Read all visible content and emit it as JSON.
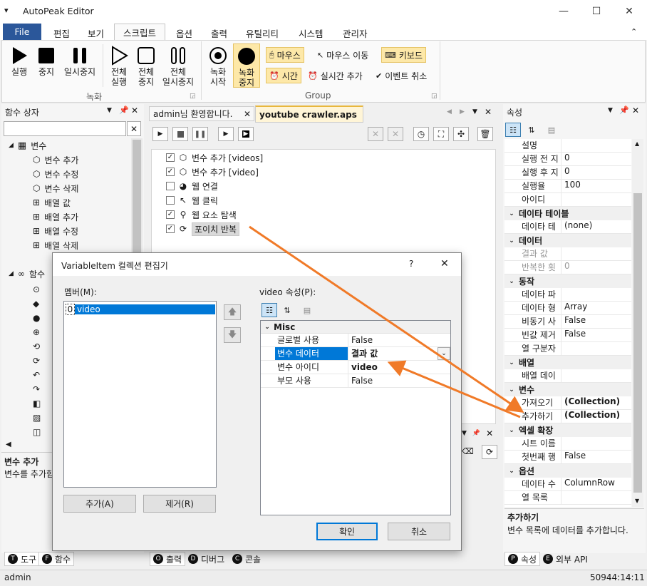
{
  "app": {
    "title": "AutoPeak Editor"
  },
  "menu": {
    "file": "File",
    "items": [
      "편집",
      "보기",
      "스크립트",
      "옵션",
      "출력",
      "유틸리티",
      "시스템",
      "관리자"
    ]
  },
  "ribbon": {
    "rec_group": "녹화",
    "group2": "Group",
    "buttons": {
      "run": "실행",
      "stop": "중지",
      "pause": "일시중지",
      "run_all_1": "전체",
      "run_all_2": "실행",
      "stop_all_1": "전체",
      "stop_all_2": "중지",
      "pause_all_1": "전체",
      "pause_all_2": "일시중지",
      "rec_start_1": "녹화",
      "rec_start_2": "시작",
      "rec_stop_1": "녹화",
      "rec_stop_2": "중지"
    },
    "chips": {
      "mouse": "마우스",
      "mouse_move": "마우스 이동",
      "keyboard": "키보드",
      "time": "시간",
      "realtime_add": "실시간 추가",
      "event_cancel": "이벤트 취소"
    }
  },
  "left_panel": {
    "title": "함수 상자",
    "search_value": "",
    "tree": {
      "var_group": "변수",
      "items": [
        "변수 추가",
        "변수 수정",
        "변수 삭제",
        "배열 값",
        "배열 추가",
        "배열 수정",
        "배열 삭제"
      ],
      "group2": "함수"
    },
    "desc_title": "변수 추가",
    "desc_text": "변수를 추가합"
  },
  "editor": {
    "tabs": [
      "admin님 환영합니다.",
      "youtube crawler.aps"
    ],
    "steps": [
      {
        "checked": true,
        "label": "변수 추가 [videos]"
      },
      {
        "checked": true,
        "label": "변수 추가 [video]"
      },
      {
        "checked": false,
        "label": "웹 연결"
      },
      {
        "checked": false,
        "label": "웹 클릭"
      },
      {
        "checked": true,
        "label": "웹 요소 탐색"
      },
      {
        "checked": true,
        "label": "포이치 반복"
      }
    ]
  },
  "props": {
    "title": "속성",
    "rows": [
      {
        "k": "설명",
        "v": ""
      },
      {
        "k": "실행 전 지",
        "v": "0"
      },
      {
        "k": "실행 후 지",
        "v": "0"
      },
      {
        "k": "실행율",
        "v": "100"
      },
      {
        "k": "아이디",
        "v": ""
      },
      {
        "cat": "데이타 테이블"
      },
      {
        "k": "데이타 테",
        "v": "(none)"
      },
      {
        "cat": "데이터"
      },
      {
        "k": "결과 값",
        "v": "",
        "dim": true
      },
      {
        "k": "반복한 횟",
        "v": "0",
        "dim": true
      },
      {
        "cat": "동작"
      },
      {
        "k": "데이타 파",
        "v": ""
      },
      {
        "k": "데이타 형",
        "v": "Array"
      },
      {
        "k": "비동기 사",
        "v": "False"
      },
      {
        "k": "빈값 제거",
        "v": "False"
      },
      {
        "k": "열 구분자",
        "v": ""
      },
      {
        "cat": "배열"
      },
      {
        "k": "배열 데이",
        "v": ""
      },
      {
        "cat": "변수"
      },
      {
        "k": "가져오기",
        "v": "(Collection)",
        "bold": true
      },
      {
        "k": "추가하기",
        "v": "(Collection)",
        "bold": true
      },
      {
        "cat": "엑셀 확장"
      },
      {
        "k": "시트 이름",
        "v": ""
      },
      {
        "k": "첫번째 행",
        "v": "False"
      },
      {
        "cat": "옵션"
      },
      {
        "k": "데이타 수",
        "v": "ColumnRow"
      },
      {
        "k": "열 목록",
        "v": ""
      }
    ],
    "desc_title": "추가하기",
    "desc_text": "변수 목록에 데이터를 추가합니다."
  },
  "bottom_tabs": {
    "left": [
      "도구",
      "함수"
    ],
    "mid": [
      "출력",
      "디버그",
      "콘솔"
    ],
    "right": [
      "속성",
      "외부 API"
    ]
  },
  "status": {
    "user": "admin",
    "time": "50944:14:11"
  },
  "dialog": {
    "title": "VariableItem 컬렉션 편집기",
    "help": "?",
    "members_label": "멤버(M):",
    "members": [
      {
        "index": "0",
        "name": "video"
      }
    ],
    "props_label": "video 속성(P):",
    "category": "Misc",
    "props": [
      {
        "k": "글로벌 사용",
        "v": "False"
      },
      {
        "k": "변수 데이터",
        "v": "결과 값",
        "selected": true
      },
      {
        "k": "변수 아이디",
        "v": "video",
        "bold": true
      },
      {
        "k": "부모 사용",
        "v": "False"
      }
    ],
    "add": "추가(A)",
    "remove": "제거(R)",
    "ok": "확인",
    "cancel": "취소"
  },
  "colors": {
    "accent": "#2b579a",
    "selection": "#0078d7",
    "annotation": "#f07a28"
  }
}
